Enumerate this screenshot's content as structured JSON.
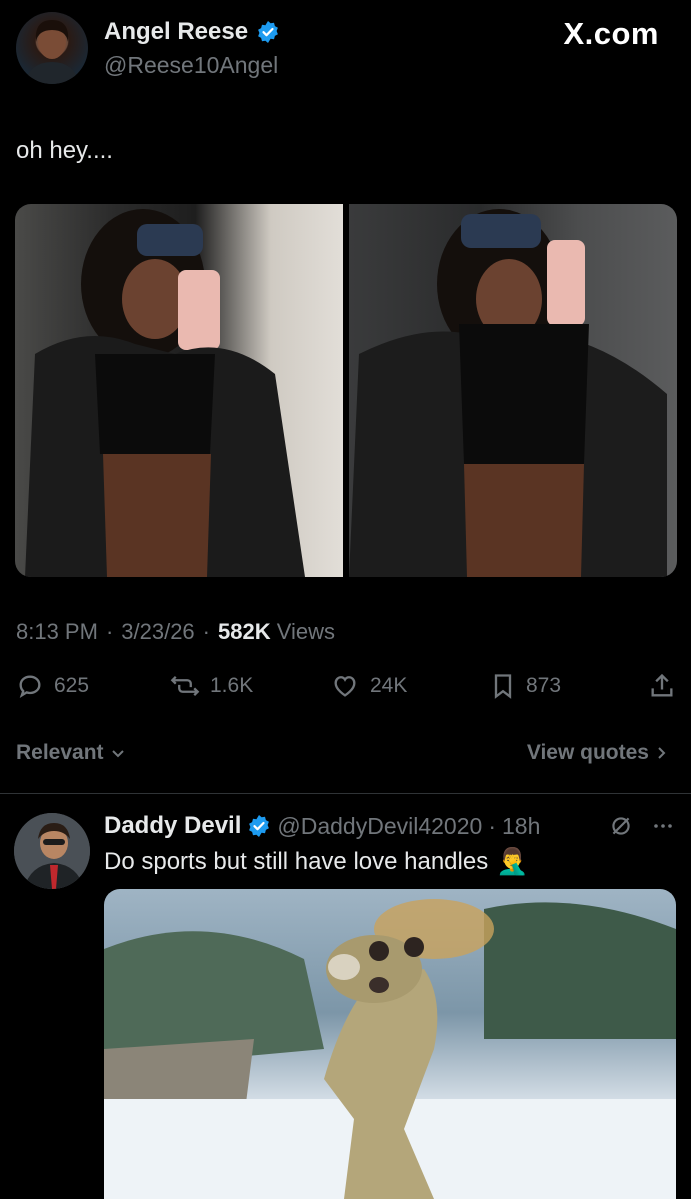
{
  "brand": {
    "logo_text": "X.com"
  },
  "tweet": {
    "author_name": "Angel Reese",
    "author_handle": "@Reese10Angel",
    "text": "oh hey....",
    "time": "8:13 PM",
    "date": "3/23/26",
    "views_count": "582K",
    "views_label": "Views",
    "sep1": "·",
    "sep2": "·",
    "actions": {
      "replies": "625",
      "reposts": "1.6K",
      "likes": "24K",
      "bookmarks": "873"
    }
  },
  "filters": {
    "sort_label": "Relevant",
    "quotes_label": "View quotes"
  },
  "reply": {
    "author_name": "Daddy Devil",
    "author_handle": "@DaddyDevil42020",
    "sep": "·",
    "age": "18h",
    "text": "Do sports but still have love handles",
    "emoji": "🤦‍♂️"
  },
  "colors": {
    "accent": "#1d9bf0",
    "muted": "#71767b",
    "text": "#e7e9ea",
    "bg": "#000000"
  }
}
